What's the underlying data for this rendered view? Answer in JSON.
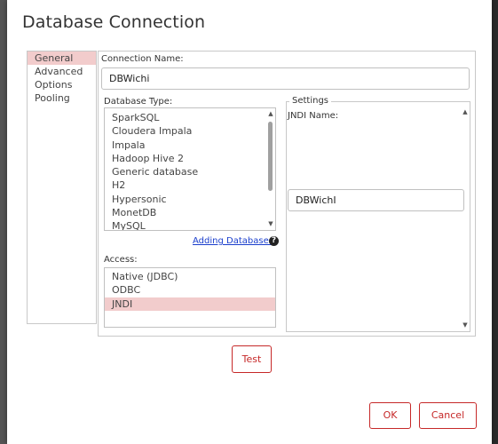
{
  "dialog": {
    "title": "Database Connection"
  },
  "nav": {
    "items": [
      {
        "label": "General",
        "selected": true
      },
      {
        "label": "Advanced",
        "selected": false
      },
      {
        "label": "Options",
        "selected": false
      },
      {
        "label": "Pooling",
        "selected": false
      }
    ]
  },
  "connection": {
    "label": "Connection Name:",
    "value": "DBWichi"
  },
  "db_type": {
    "label": "Database Type:",
    "options": [
      "SparkSQL",
      "Cloudera Impala",
      "Impala",
      "Hadoop Hive 2",
      "Generic database",
      "H2",
      "Hypersonic",
      "MonetDB",
      "MySQL"
    ]
  },
  "adding_databases": {
    "label": "Adding Databases"
  },
  "access": {
    "label": "Access:",
    "options": [
      {
        "label": "Native (JDBC)",
        "selected": false
      },
      {
        "label": "ODBC",
        "selected": false
      },
      {
        "label": "JNDI",
        "selected": true
      }
    ]
  },
  "settings": {
    "legend": "Settings",
    "jndi_label": "JNDI Name:",
    "jndi_value": "DBWichI"
  },
  "buttons": {
    "test": "Test",
    "ok": "OK",
    "cancel": "Cancel"
  },
  "colors": {
    "accent": "#c62828",
    "selection": "#f2cccc",
    "link": "#1a3ecc"
  }
}
